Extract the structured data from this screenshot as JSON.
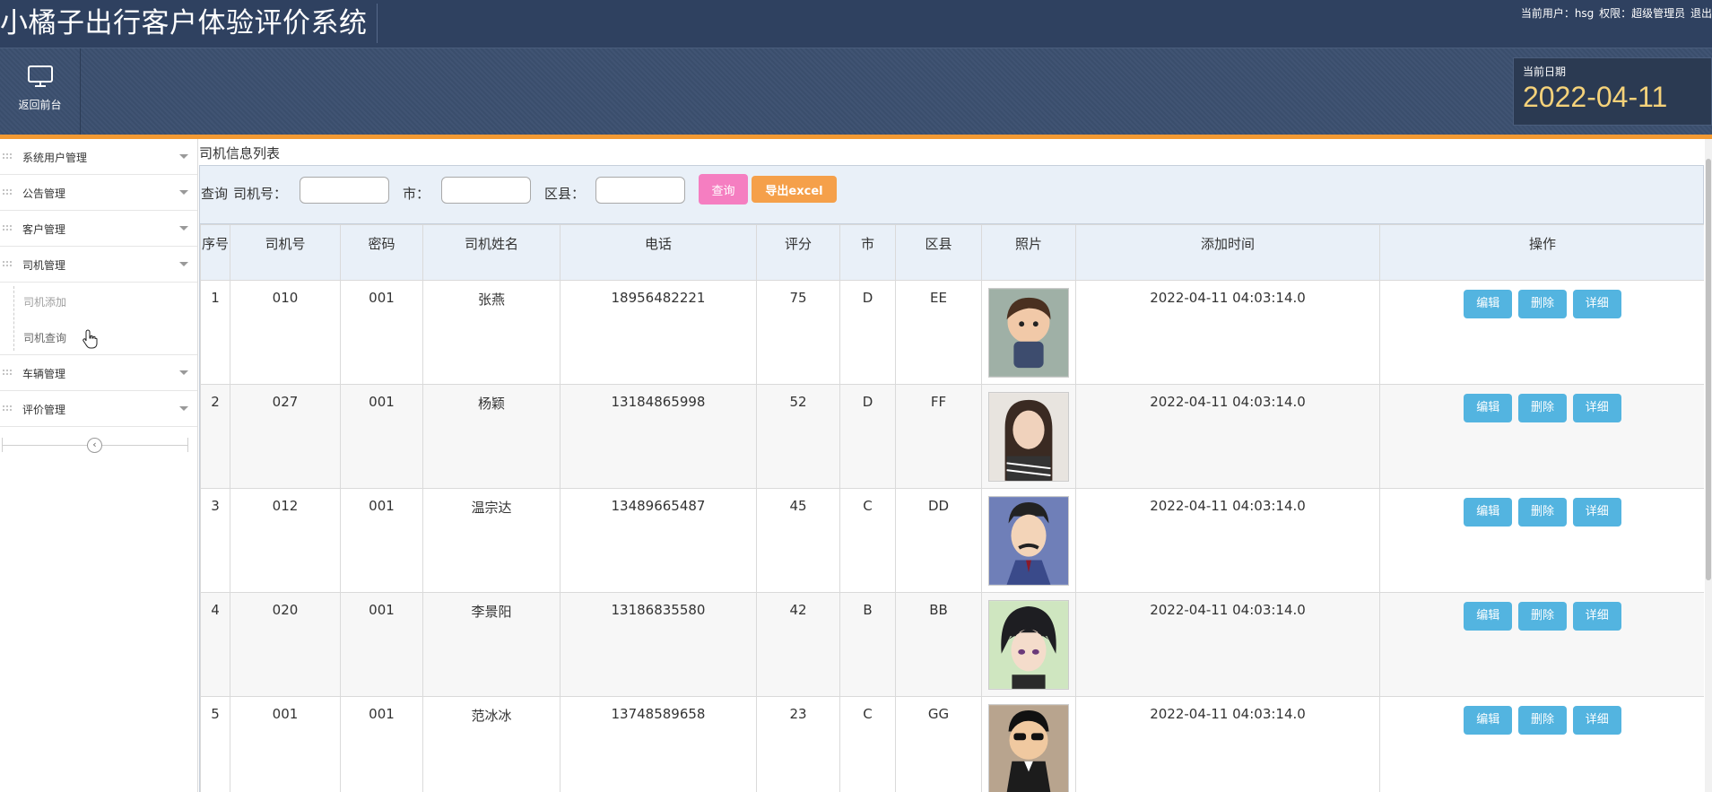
{
  "app": {
    "title": "小橘子出行客户体验评价系统",
    "user_label": "当前用户：hsg",
    "role_label": "权限：超级管理员",
    "logout_label": "退出"
  },
  "toolbar": {
    "home_label": "返回前台",
    "date_caption": "当前日期",
    "date_value": "2022-04-11"
  },
  "sidebar": {
    "items": [
      {
        "label": "系统用户管理"
      },
      {
        "label": "公告管理"
      },
      {
        "label": "客户管理"
      },
      {
        "label": "司机管理"
      },
      {
        "label": "车辆管理"
      },
      {
        "label": "评价管理"
      }
    ],
    "sub_items": [
      {
        "label": "司机添加"
      },
      {
        "label": "司机查询"
      }
    ]
  },
  "main": {
    "section_title": "司机信息列表",
    "search": {
      "prefix": "查询",
      "driver_no_label": "司机号：",
      "city_label": "市：",
      "district_label": "区县：",
      "driver_no_value": "",
      "city_value": "",
      "district_value": "",
      "query_button": "查询",
      "export_button": "导出excel"
    },
    "table": {
      "columns": [
        "序号",
        "司机号",
        "密码",
        "司机姓名",
        "电话",
        "评分",
        "市",
        "区县",
        "照片",
        "添加时间",
        "操作"
      ],
      "actions": {
        "edit": "编辑",
        "delete": "删除",
        "detail": "详细"
      },
      "rows": [
        {
          "index": "1",
          "driver_no": "010",
          "password": "001",
          "name": "张燕",
          "phone": "18956482221",
          "score": "75",
          "city": "D",
          "district": "EE",
          "photo": "cartoon-boy-avatar",
          "added": "2022-04-11 04:03:14.0"
        },
        {
          "index": "2",
          "driver_no": "027",
          "password": "001",
          "name": "杨颖",
          "phone": "13184865998",
          "score": "52",
          "city": "D",
          "district": "FF",
          "photo": "woman-portrait",
          "added": "2022-04-11 04:03:14.0"
        },
        {
          "index": "3",
          "driver_no": "012",
          "password": "001",
          "name": "温宗达",
          "phone": "13489665487",
          "score": "45",
          "city": "C",
          "district": "DD",
          "photo": "anime-man-mustache",
          "added": "2022-04-11 04:03:14.0"
        },
        {
          "index": "4",
          "driver_no": "020",
          "password": "001",
          "name": "李景阳",
          "phone": "13186835580",
          "score": "42",
          "city": "B",
          "district": "BB",
          "photo": "anime-dark-hair",
          "added": "2022-04-11 04:03:14.0"
        },
        {
          "index": "5",
          "driver_no": "001",
          "password": "001",
          "name": "范冰冰",
          "phone": "13748589658",
          "score": "23",
          "city": "C",
          "district": "GG",
          "photo": "cartoon-sunglasses-man",
          "added": "2022-04-11 04:03:14.0"
        }
      ]
    }
  },
  "colors": {
    "header_bg": "#2f4160",
    "accent_orange": "#f39a33",
    "date_yellow": "#f5d27a",
    "query_pink": "#f57ec1",
    "export_orange": "#f5a04a",
    "action_blue": "#53b4e0"
  }
}
